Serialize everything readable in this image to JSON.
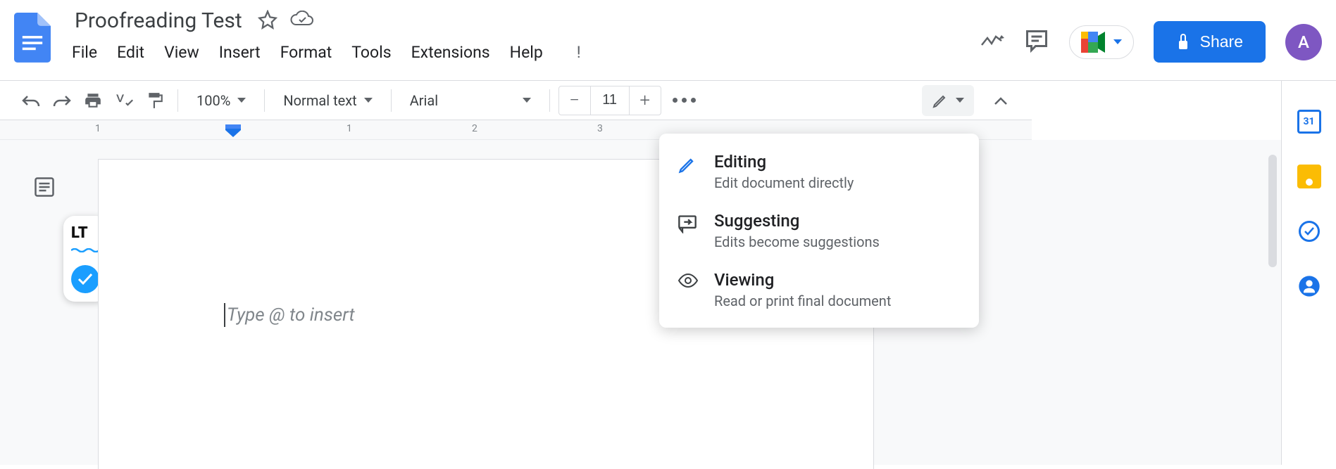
{
  "document": {
    "title": "Proofreading Test",
    "placeholder": "Type @ to insert"
  },
  "menus": [
    "File",
    "Edit",
    "View",
    "Insert",
    "Format",
    "Tools",
    "Extensions",
    "Help"
  ],
  "toolbar": {
    "zoom": "100%",
    "style": "Normal text",
    "font": "Arial",
    "font_size": "11"
  },
  "share": {
    "label": "Share"
  },
  "avatar": {
    "initial": "A"
  },
  "mode_menu": [
    {
      "title": "Editing",
      "desc": "Edit document directly",
      "icon": "pencil"
    },
    {
      "title": "Suggesting",
      "desc": "Edits become suggestions",
      "icon": "suggest"
    },
    {
      "title": "Viewing",
      "desc": "Read or print final document",
      "icon": "eye"
    }
  ],
  "ruler": {
    "marks": [
      "1",
      "1",
      "2",
      "3"
    ]
  },
  "side_panel": {
    "calendar_day": "31"
  }
}
